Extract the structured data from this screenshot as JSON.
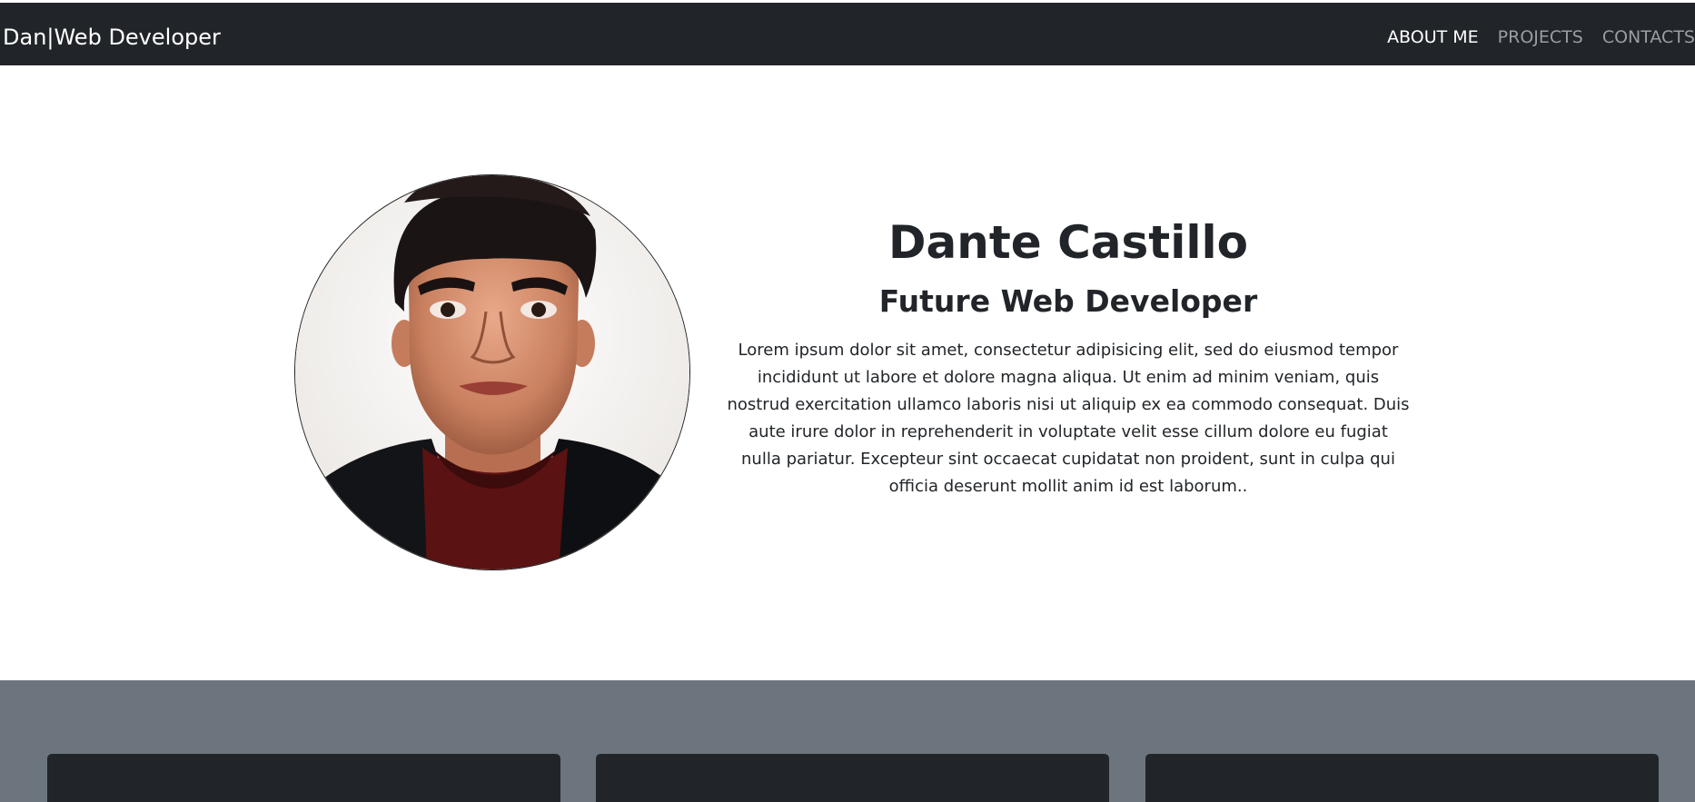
{
  "navbar": {
    "brand": "Dan|Web Developer",
    "links": [
      {
        "label": "ABOUT ME",
        "active": true
      },
      {
        "label": "PROJECTS",
        "active": false
      },
      {
        "label": "CONTACTS",
        "active": false
      }
    ]
  },
  "hero": {
    "name": "Dante Castillo",
    "role": "Future Web Developer",
    "bio": "Lorem ipsum dolor sit amet, consectetur adipisicing elit, sed do eiusmod tempor incididunt ut labore et dolore magna aliqua. Ut enim ad minim veniam, quis nostrud exercitation ullamco laboris nisi ut aliquip ex ea commodo consequat. Duis aute irure dolor in reprehenderit in voluptate velit esse cillum dolore eu fugiat nulla pariatur. Excepteur sint occaecat cupidatat non proident, sunt in culpa qui officia deserunt mollit anim id est laborum.."
  },
  "colors": {
    "navbar_bg": "#212529",
    "section_bg": "#6c757d",
    "card_bg": "#212529",
    "nav_link_muted": "#9a9da1",
    "nav_link_active": "#ffffff"
  }
}
